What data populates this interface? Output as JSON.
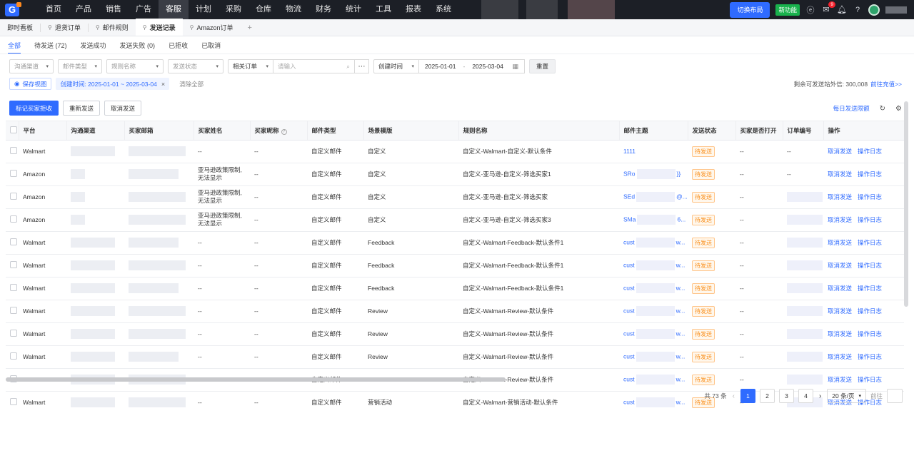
{
  "topnav": {
    "logo_letter": "G",
    "items": [
      "首页",
      "产品",
      "销售",
      "广告",
      "客服",
      "计划",
      "采购",
      "仓库",
      "物流",
      "财务",
      "统计",
      "工具",
      "报表",
      "系统"
    ],
    "active_index": 4,
    "layout_button": "切换布局",
    "new_feature": "新功能",
    "notification_count": "9"
  },
  "tabs": {
    "items": [
      {
        "label": "即时看板",
        "pinned": false
      },
      {
        "label": "退货订单",
        "pinned": true
      },
      {
        "label": "邮件规则",
        "pinned": true
      },
      {
        "label": "发送记录",
        "pinned": true
      },
      {
        "label": "Amazon订单",
        "pinned": true
      }
    ],
    "active_index": 3,
    "add": "+"
  },
  "status_tabs": [
    "全部",
    "待发送 (72)",
    "发送成功",
    "发送失败 (0)",
    "已拒收",
    "已取消"
  ],
  "filters": {
    "channel": "沟通渠道",
    "mail_type": "邮件类型",
    "rule_name": "规则名称",
    "send_status": "发送状态",
    "related": "相关订单",
    "search_placeholder": "请输入",
    "time_type": "创建时间",
    "date_from": "2025-01-01",
    "date_sep": "-",
    "date_to": "2025-03-04",
    "reset": "重置"
  },
  "saved": {
    "save_view": "保存视图",
    "chip": "创建时间: 2025-01-01 ~ 2025-03-04",
    "clear_all": "清除全部",
    "quota_label": "剩余可发送站外信: 300,008",
    "quota_link": "前往充值>>"
  },
  "actions": {
    "mark_reject": "标记买家拒收",
    "resend": "重新发送",
    "cancel": "取消发送",
    "daily_limit": "每日发送限额"
  },
  "table": {
    "headers": {
      "platform": "平台",
      "channel": "沟通渠道",
      "buyer_email": "买家邮箱",
      "buyer_name": "买家姓名",
      "buyer_nick": "买家昵称",
      "mail_type": "邮件类型",
      "scene": "场景模版",
      "rule_name": "规则名称",
      "subject": "邮件主题",
      "send_status": "发送状态",
      "opened": "买家是否打开",
      "order_no": "订单编号",
      "ops": "操作"
    },
    "op_cancel": "取消发送",
    "op_log": "操作日志",
    "rows": [
      {
        "platform": "Walmart",
        "name": "--",
        "nick": "--",
        "type": "自定义邮件",
        "scene": "自定义",
        "rule": "自定义-Walmart-自定义-默认条件",
        "subj_pre": "1111",
        "subj_post": "",
        "status": "待发送",
        "opened": "--",
        "order": "--"
      },
      {
        "platform": "Amazon",
        "name": "亚马逊政策限制,无法显示",
        "nick": "--",
        "type": "自定义邮件",
        "scene": "自定义",
        "rule": "自定义-亚马逊-自定义-筛选买家1",
        "subj_pre": "SRo",
        "subj_post": "}}",
        "status": "待发送",
        "opened": "--",
        "order": "--"
      },
      {
        "platform": "Amazon",
        "name": "亚马逊政策限制,无法显示",
        "nick": "--",
        "type": "自定义邮件",
        "scene": "自定义",
        "rule": "自定义-亚马逊-自定义-筛选买家",
        "subj_pre": "SEd",
        "subj_post": "@...",
        "status": "待发送",
        "opened": "--",
        "order": ""
      },
      {
        "platform": "Amazon",
        "name": "亚马逊政策限制,无法显示",
        "nick": "--",
        "type": "自定义邮件",
        "scene": "自定义",
        "rule": "自定义-亚马逊-自定义-筛选买家3",
        "subj_pre": "SMa",
        "subj_post": "6...",
        "status": "待发送",
        "opened": "--",
        "order": ""
      },
      {
        "platform": "Walmart",
        "name": "--",
        "nick": "--",
        "type": "自定义邮件",
        "scene": "Feedback",
        "rule": "自定义-Walmart-Feedback-默认条件1",
        "subj_pre": "cust",
        "subj_post": "w...",
        "status": "待发送",
        "opened": "--",
        "order": ""
      },
      {
        "platform": "Walmart",
        "name": "--",
        "nick": "--",
        "type": "自定义邮件",
        "scene": "Feedback",
        "rule": "自定义-Walmart-Feedback-默认条件1",
        "subj_pre": "cust",
        "subj_post": "w...",
        "status": "待发送",
        "opened": "--",
        "order": ""
      },
      {
        "platform": "Walmart",
        "name": "--",
        "nick": "--",
        "type": "自定义邮件",
        "scene": "Feedback",
        "rule": "自定义-Walmart-Feedback-默认条件1",
        "subj_pre": "cust",
        "subj_post": "w...",
        "status": "待发送",
        "opened": "--",
        "order": ""
      },
      {
        "platform": "Walmart",
        "name": "--",
        "nick": "--",
        "type": "自定义邮件",
        "scene": "Review",
        "rule": "自定义-Walmart-Review-默认条件",
        "subj_pre": "cust",
        "subj_post": "w...",
        "status": "待发送",
        "opened": "--",
        "order": ""
      },
      {
        "platform": "Walmart",
        "name": "--",
        "nick": "--",
        "type": "自定义邮件",
        "scene": "Review",
        "rule": "自定义-Walmart-Review-默认条件",
        "subj_pre": "cust",
        "subj_post": "w...",
        "status": "待发送",
        "opened": "--",
        "order": ""
      },
      {
        "platform": "Walmart",
        "name": "--",
        "nick": "--",
        "type": "自定义邮件",
        "scene": "Review",
        "rule": "自定义-Walmart-Review-默认条件",
        "subj_pre": "cust",
        "subj_post": "w...",
        "status": "待发送",
        "opened": "--",
        "order": ""
      },
      {
        "platform": "Walmart",
        "name": "--",
        "nick": "--",
        "type": "自定义邮件",
        "scene": "Review",
        "rule": "自定义-Walmart-Review-默认条件",
        "subj_pre": "cust",
        "subj_post": "w...",
        "status": "待发送",
        "opened": "--",
        "order": ""
      },
      {
        "platform": "Walmart",
        "name": "--",
        "nick": "--",
        "type": "自定义邮件",
        "scene": "营销活动",
        "rule": "自定义-Walmart-营销活动-默认条件",
        "subj_pre": "cust",
        "subj_post": "w...",
        "status": "待发送",
        "opened": "--",
        "order": ""
      }
    ]
  },
  "pagination": {
    "total": "共 73 条",
    "pages": [
      "1",
      "2",
      "3",
      "4"
    ],
    "active_page": "1",
    "page_size": "20 条/页",
    "goto": "前往"
  },
  "colors": {
    "primary": "#2f6bff",
    "nav_bg": "#1c1f26",
    "pending": "#fa8c16",
    "new_badge": "#19b14d"
  },
  "icons": [
    "search-icon",
    "more-icon",
    "calendar-icon",
    "eye-icon",
    "close-icon",
    "refresh-icon",
    "settings-icon",
    "bell-icon",
    "help-icon",
    "message-icon",
    "chevron-down-icon",
    "pin-icon"
  ]
}
